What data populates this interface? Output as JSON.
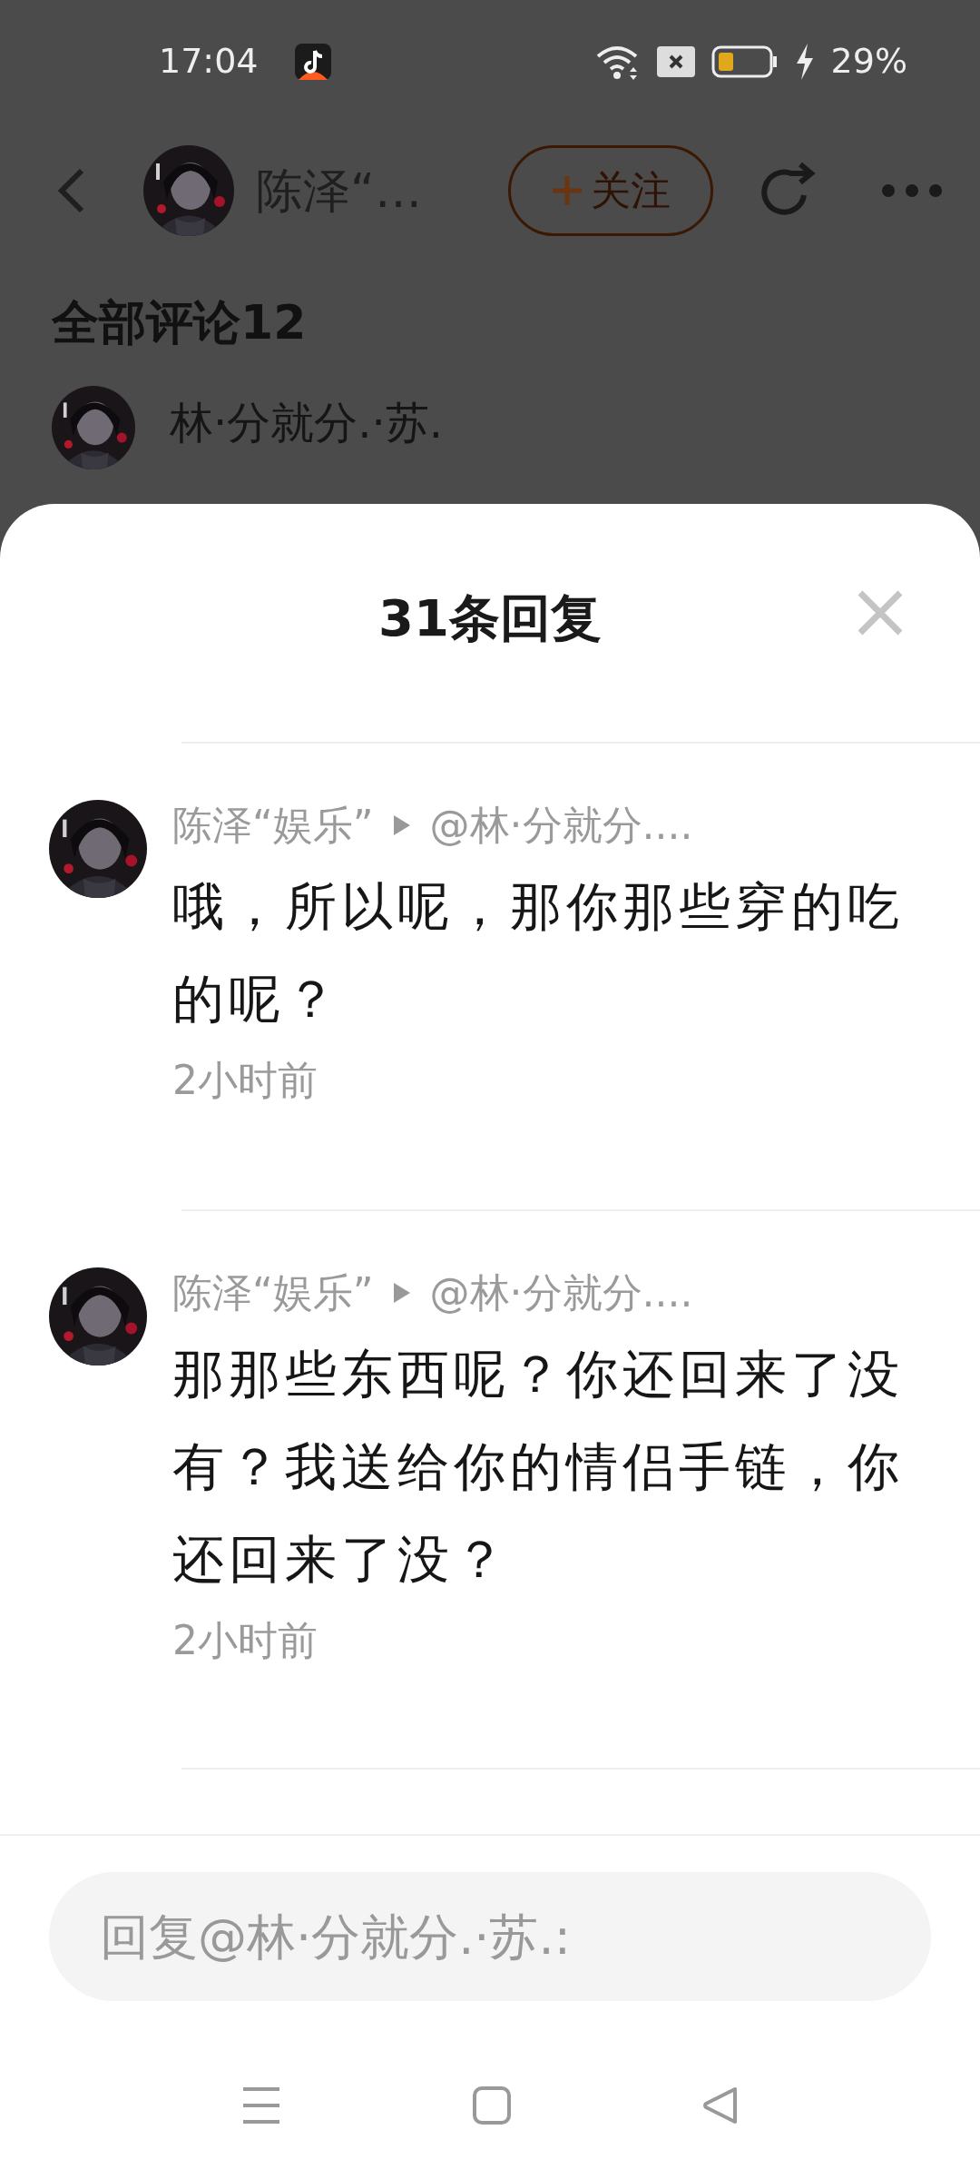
{
  "status_bar": {
    "time": "17:04",
    "battery_text": "29%"
  },
  "header": {
    "user_name": "陈泽“…",
    "follow_label": "关注"
  },
  "section_title": "全部评论12",
  "background_comment": {
    "user_name": "林·分就分.·苏."
  },
  "sheet": {
    "title": "31条回复"
  },
  "replies": [
    {
      "author": "陈泽“娱乐”",
      "reply_to": "@林·分就分....",
      "text": "哦，所以呢，那你那些穿的吃的呢？",
      "time": "2小时前"
    },
    {
      "author": "陈泽“娱乐”",
      "reply_to": "@林·分就分....",
      "text": "那那些东西呢？你还回来了没有？我送给你的情侣手链，你还回来了没？",
      "time": "2小时前"
    }
  ],
  "reply_input": {
    "placeholder": "回复@林·分就分.·苏.:"
  }
}
